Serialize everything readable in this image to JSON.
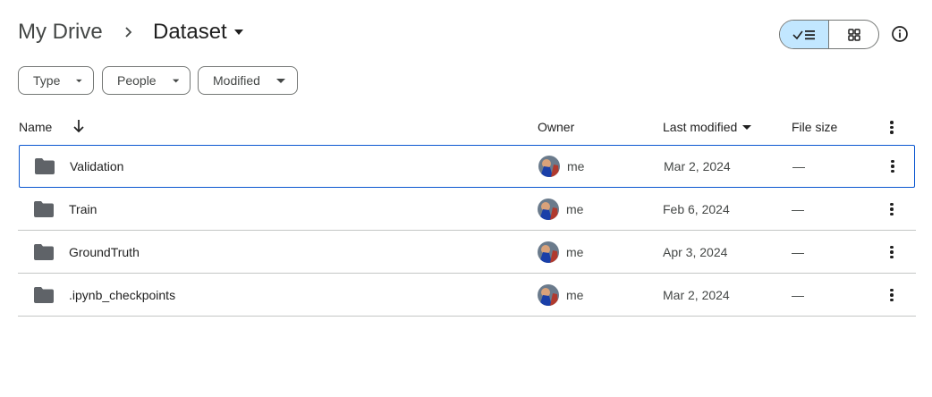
{
  "breadcrumb": {
    "root": "My Drive",
    "current": "Dataset"
  },
  "view_toggle": {
    "active": "list",
    "icons": [
      "check-list-icon",
      "grid-icon"
    ]
  },
  "filters": [
    {
      "label": "Type"
    },
    {
      "label": "People"
    },
    {
      "label": "Modified"
    }
  ],
  "table": {
    "columns": {
      "name": "Name",
      "owner": "Owner",
      "last_modified": "Last modified",
      "file_size": "File size"
    },
    "rows": [
      {
        "name": "Validation",
        "owner": "me",
        "modified": "Mar 2, 2024",
        "size": "—",
        "selected": true
      },
      {
        "name": "Train",
        "owner": "me",
        "modified": "Feb 6, 2024",
        "size": "—",
        "selected": false
      },
      {
        "name": "GroundTruth",
        "owner": "me",
        "modified": "Apr 3, 2024",
        "size": "—",
        "selected": false
      },
      {
        "name": ".ipynb_checkpoints",
        "owner": "me",
        "modified": "Mar 2, 2024",
        "size": "—",
        "selected": false
      }
    ]
  },
  "colors": {
    "accent": "#0b57d0",
    "toggle_active": "#c2e7ff",
    "border": "#747775",
    "divider": "#c4c7c5",
    "folder": "#5f6368"
  }
}
